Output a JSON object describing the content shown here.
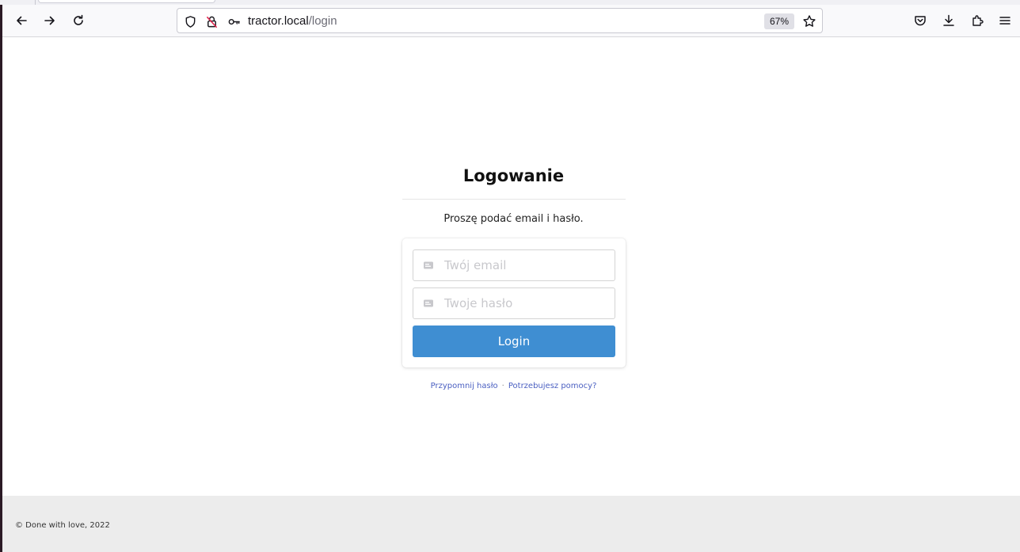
{
  "browser": {
    "url_host": "tractor.local",
    "url_path": "/login",
    "zoom_level": "67%",
    "icons": {
      "back": "arrow-left-icon",
      "forward": "arrow-right-icon",
      "reload": "reload-icon",
      "shield": "shield-icon",
      "insecure": "insecure-lock-icon",
      "key": "key-icon",
      "bookmark": "star-icon",
      "pocket": "pocket-icon",
      "downloads": "download-icon",
      "extensions": "puzzle-icon",
      "menu": "hamburger-menu-icon"
    }
  },
  "page": {
    "title": "Logowanie",
    "subtitle": "Proszę podać email i hasło.",
    "email_placeholder": "Twój email",
    "password_placeholder": "Twoje hasło",
    "login_label": "Login",
    "remind_password_link": "Przypomnij hasło",
    "separator": "·",
    "help_link": "Potrzebujesz pomocy?",
    "accent_color": "#3f8ed2",
    "link_color": "#4a5fc1"
  },
  "footer": {
    "text": "© Done with love, 2022"
  }
}
